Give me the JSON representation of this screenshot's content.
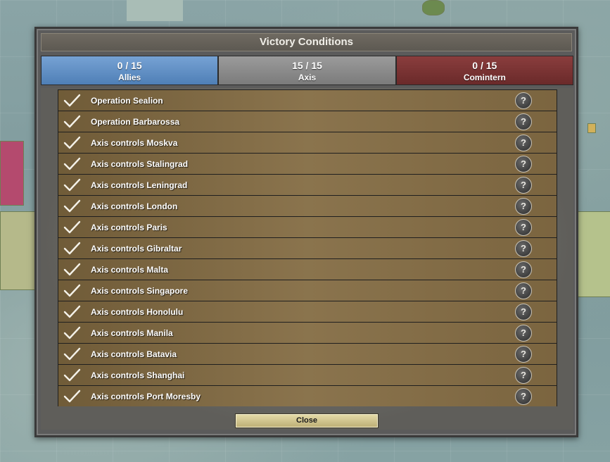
{
  "dialog": {
    "title": "Victory Conditions",
    "close_label": "Close"
  },
  "tabs": [
    {
      "score": "0 / 15",
      "name": "Allies",
      "color": "#5f8ec4"
    },
    {
      "score": "15 / 15",
      "name": "Axis",
      "color": "#8b8b8b"
    },
    {
      "score": "0 / 15",
      "name": "Comintern",
      "color": "#7a3232"
    }
  ],
  "conditions": [
    {
      "label": "Operation Sealion",
      "completed": true,
      "icon": "checkmark-icon",
      "help": "?"
    },
    {
      "label": "Operation Barbarossa",
      "completed": true,
      "icon": "checkmark-icon",
      "help": "?"
    },
    {
      "label": "Axis controls Moskva",
      "completed": true,
      "icon": "checkmark-icon",
      "help": "?"
    },
    {
      "label": "Axis controls Stalingrad",
      "completed": true,
      "icon": "checkmark-icon",
      "help": "?"
    },
    {
      "label": "Axis controls Leningrad",
      "completed": true,
      "icon": "checkmark-icon",
      "help": "?"
    },
    {
      "label": "Axis controls London",
      "completed": true,
      "icon": "checkmark-icon",
      "help": "?"
    },
    {
      "label": "Axis controls Paris",
      "completed": true,
      "icon": "checkmark-icon",
      "help": "?"
    },
    {
      "label": "Axis controls Gibraltar",
      "completed": true,
      "icon": "checkmark-icon",
      "help": "?"
    },
    {
      "label": "Axis controls Malta",
      "completed": true,
      "icon": "checkmark-icon",
      "help": "?"
    },
    {
      "label": "Axis controls Singapore",
      "completed": true,
      "icon": "checkmark-icon",
      "help": "?"
    },
    {
      "label": "Axis controls Honolulu",
      "completed": true,
      "icon": "checkmark-icon",
      "help": "?"
    },
    {
      "label": "Axis controls Manila",
      "completed": true,
      "icon": "checkmark-icon",
      "help": "?"
    },
    {
      "label": "Axis controls Batavia",
      "completed": true,
      "icon": "checkmark-icon",
      "help": "?"
    },
    {
      "label": "Axis controls Shanghai",
      "completed": true,
      "icon": "checkmark-icon",
      "help": "?"
    },
    {
      "label": "Axis controls Port Moresby",
      "completed": true,
      "icon": "checkmark-icon",
      "help": "?"
    }
  ]
}
